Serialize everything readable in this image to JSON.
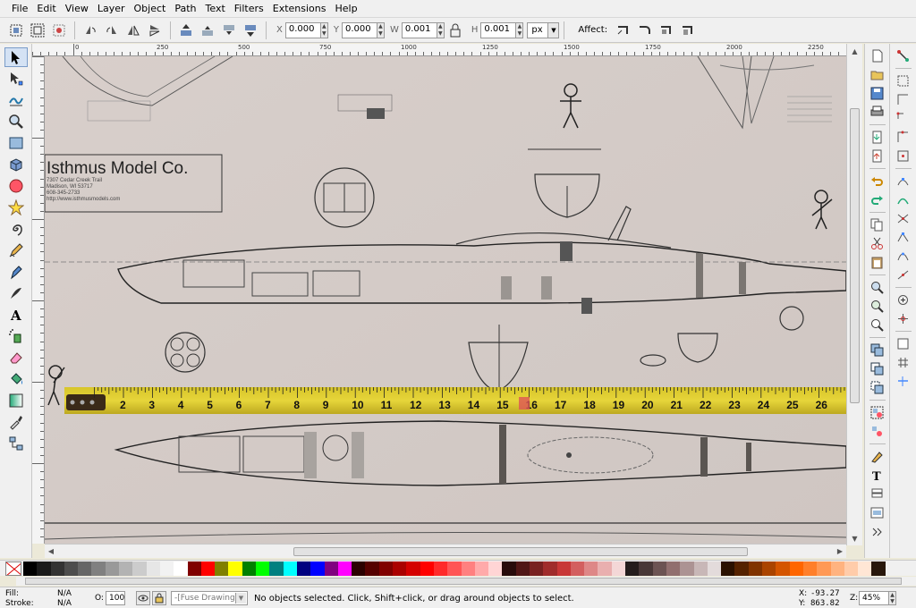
{
  "menu": [
    "File",
    "Edit",
    "View",
    "Layer",
    "Object",
    "Path",
    "Text",
    "Filters",
    "Extensions",
    "Help"
  ],
  "toolbar": {
    "x_label": "X",
    "x_value": "0.000",
    "y_label": "Y",
    "y_value": "0.000",
    "w_label": "W",
    "w_value": "0.001",
    "h_label": "H",
    "h_value": "0.001",
    "unit": "px",
    "affect_label": "Affect:"
  },
  "ruler": {
    "labels": [
      "0",
      "250",
      "500",
      "750",
      "1000",
      "1250",
      "1500",
      "1750",
      "2000",
      "2250"
    ]
  },
  "drawing": {
    "company_name": "Isthmus Model Co.",
    "address_1": "7307 Cedar Creek Trail",
    "address_2": "Madison, WI 53717",
    "phone": "608-345-2733",
    "website": "http://www.isthmusmodels.com",
    "tape_numbers": [
      "2",
      "3",
      "4",
      "5",
      "6",
      "7",
      "8",
      "9",
      "10",
      "11",
      "12",
      "13",
      "14",
      "15",
      "16",
      "17",
      "18",
      "19",
      "20",
      "21",
      "22",
      "23",
      "24",
      "25",
      "26"
    ]
  },
  "palette": {
    "colors": [
      "#000000",
      "#1a1a1a",
      "#333333",
      "#4d4d4d",
      "#666666",
      "#808080",
      "#999999",
      "#b3b3b3",
      "#cccccc",
      "#e6e6e6",
      "#f2f2f2",
      "#ffffff",
      "#800000",
      "#ff0000",
      "#808000",
      "#ffff00",
      "#008000",
      "#00ff00",
      "#008080",
      "#00ffff",
      "#000080",
      "#0000ff",
      "#800080",
      "#ff00ff",
      "#2b0000",
      "#550000",
      "#800000",
      "#aa0000",
      "#d40000",
      "#ff0000",
      "#ff2a2a",
      "#ff5555",
      "#ff8080",
      "#ffaaaa",
      "#ffd5d5",
      "#280b0b",
      "#501616",
      "#782121",
      "#a02c2c",
      "#c83737",
      "#d35f5f",
      "#de8787",
      "#e9afaf",
      "#f4d7d7",
      "#241c1c",
      "#483737",
      "#6c5353",
      "#916f6f",
      "#ac9393",
      "#c8b7b7",
      "#e3dbdb",
      "#2b1100",
      "#552200",
      "#803300",
      "#aa4400",
      "#d45500",
      "#ff6600",
      "#ff7f2a",
      "#ff9955",
      "#ffb380",
      "#ffccaa",
      "#ffe6d5",
      "#28170b"
    ]
  },
  "status": {
    "fill_label": "Fill:",
    "fill_value": "N/A",
    "stroke_label": "Stroke:",
    "stroke_value": "N/A",
    "opacity_label": "O:",
    "opacity_value": "100",
    "layer": "-[Fuse Drawing]",
    "message": "No objects selected. Click, Shift+click, or drag around objects to select.",
    "x_label": "X:",
    "x_value": "-93.27",
    "y_label": "Y:",
    "y_value": "863.82",
    "zoom_label": "Z:",
    "zoom_value": "45%"
  }
}
